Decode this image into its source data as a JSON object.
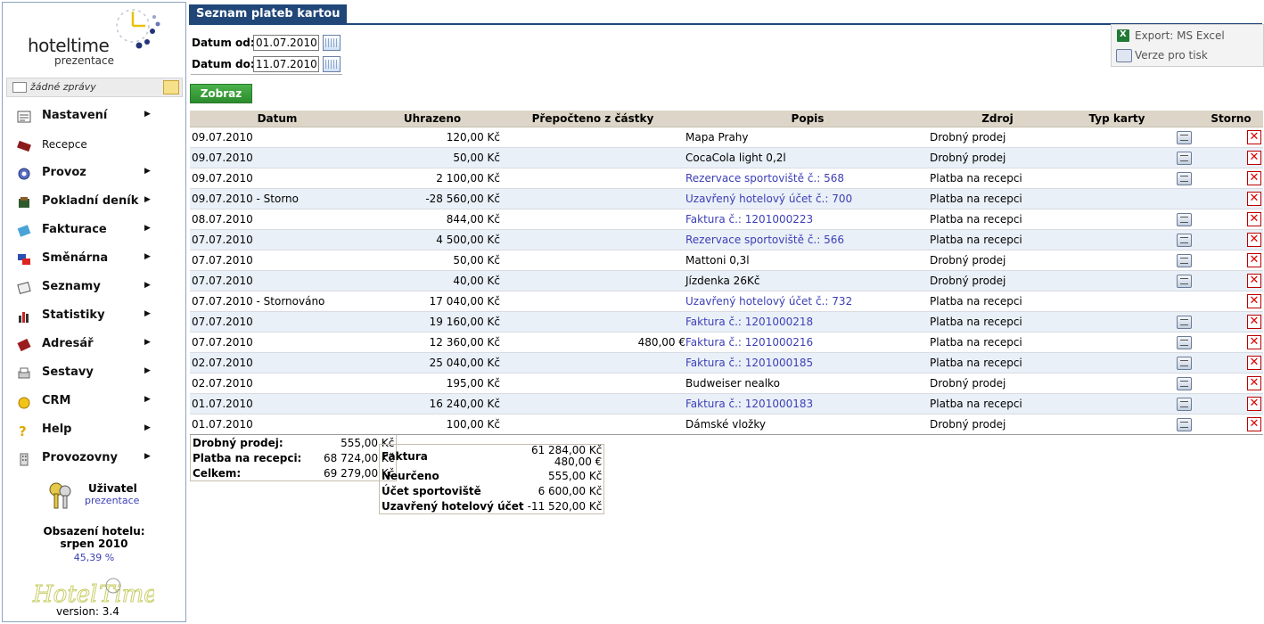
{
  "app": {
    "logo_text": "hoteltime",
    "logo_sub": "prezentace",
    "messages": "žádné zprávy"
  },
  "menu": [
    {
      "label": "Nastavení",
      "icon": "settings-icon",
      "arrow": true
    },
    {
      "label": "Recepce",
      "icon": "reception-icon",
      "arrow": false
    },
    {
      "label": "Provoz",
      "icon": "operations-icon",
      "arrow": true
    },
    {
      "label": "Pokladní deník",
      "icon": "cashbook-icon",
      "arrow": true
    },
    {
      "label": "Fakturace",
      "icon": "invoice-icon",
      "arrow": true
    },
    {
      "label": "Směnárna",
      "icon": "exchange-icon",
      "arrow": true
    },
    {
      "label": "Seznamy",
      "icon": "lists-icon",
      "arrow": true
    },
    {
      "label": "Statistiky",
      "icon": "statistics-icon",
      "arrow": true
    },
    {
      "label": "Adresář",
      "icon": "address-book-icon",
      "arrow": true
    },
    {
      "label": "Sestavy",
      "icon": "reports-icon",
      "arrow": true
    },
    {
      "label": "CRM",
      "icon": "crm-icon",
      "arrow": true
    },
    {
      "label": "Help",
      "icon": "help-icon",
      "arrow": true
    },
    {
      "label": "Provozovny",
      "icon": "branches-icon",
      "arrow": true
    }
  ],
  "user": {
    "title": "Uživatel",
    "name": "prezentace"
  },
  "occupancy": {
    "line1": "Obsazení hotelu:",
    "line2": "srpen 2010",
    "value": "45,39 %"
  },
  "version": "version: 3.4",
  "page": {
    "title": "Seznam plateb kartou"
  },
  "filters": {
    "from_label": "Datum od:",
    "from_value": "01.07.2010",
    "to_label": "Datum do:",
    "to_value": "11.07.2010",
    "show_button": "Zobraz"
  },
  "export": {
    "excel": "Export: MS Excel",
    "print": "Verze pro tisk"
  },
  "table": {
    "headers": [
      "Datum",
      "Uhrazeno",
      "Přepočteno z částky",
      "Popis",
      "Zdroj",
      "Typ karty",
      "",
      "Storno"
    ],
    "rows": [
      {
        "datum": "09.07.2010",
        "uhrazeno": "120,00 Kč",
        "prepocteno": "",
        "popis": "Mapa Prahy",
        "link": false,
        "zdroj": "Drobný prodej",
        "print": true
      },
      {
        "datum": "09.07.2010",
        "uhrazeno": "50,00 Kč",
        "prepocteno": "",
        "popis": "CocaCola light 0,2l",
        "link": false,
        "zdroj": "Drobný prodej",
        "print": true
      },
      {
        "datum": "09.07.2010",
        "uhrazeno": "2 100,00 Kč",
        "prepocteno": "",
        "popis": "Rezervace sportoviště č.: 568",
        "link": true,
        "zdroj": "Platba na recepci",
        "print": true
      },
      {
        "datum": "09.07.2010 - Storno",
        "uhrazeno": "-28 560,00 Kč",
        "prepocteno": "",
        "popis": "Uzavřený hotelový účet č.: 700",
        "link": true,
        "zdroj": "Platba na recepci",
        "print": false
      },
      {
        "datum": "08.07.2010",
        "uhrazeno": "844,00 Kč",
        "prepocteno": "",
        "popis": "Faktura č.: 1201000223",
        "link": true,
        "zdroj": "Platba na recepci",
        "print": true
      },
      {
        "datum": "07.07.2010",
        "uhrazeno": "4 500,00 Kč",
        "prepocteno": "",
        "popis": "Rezervace sportoviště č.: 566",
        "link": true,
        "zdroj": "Platba na recepci",
        "print": true
      },
      {
        "datum": "07.07.2010",
        "uhrazeno": "50,00 Kč",
        "prepocteno": "",
        "popis": "Mattoni 0,3l",
        "link": false,
        "zdroj": "Drobný prodej",
        "print": true
      },
      {
        "datum": "07.07.2010",
        "uhrazeno": "40,00 Kč",
        "prepocteno": "",
        "popis": "Jízdenka 26Kč",
        "link": false,
        "zdroj": "Drobný prodej",
        "print": true
      },
      {
        "datum": "07.07.2010 - Stornováno",
        "uhrazeno": "17 040,00 Kč",
        "prepocteno": "",
        "popis": "Uzavřený hotelový účet č.: 732",
        "link": true,
        "zdroj": "Platba na recepci",
        "print": false
      },
      {
        "datum": "07.07.2010",
        "uhrazeno": "19 160,00 Kč",
        "prepocteno": "",
        "popis": "Faktura č.: 1201000218",
        "link": true,
        "zdroj": "Platba na recepci",
        "print": true
      },
      {
        "datum": "07.07.2010",
        "uhrazeno": "12 360,00 Kč",
        "prepocteno": "480,00 €",
        "popis": "Faktura č.: 1201000216",
        "link": true,
        "zdroj": "Platba na recepci",
        "print": true
      },
      {
        "datum": "02.07.2010",
        "uhrazeno": "25 040,00 Kč",
        "prepocteno": "",
        "popis": "Faktura č.: 1201000185",
        "link": true,
        "zdroj": "Platba na recepci",
        "print": true
      },
      {
        "datum": "02.07.2010",
        "uhrazeno": "195,00 Kč",
        "prepocteno": "",
        "popis": "Budweiser nealko",
        "link": false,
        "zdroj": "Drobný prodej",
        "print": true
      },
      {
        "datum": "01.07.2010",
        "uhrazeno": "16 240,00 Kč",
        "prepocteno": "",
        "popis": "Faktura č.: 1201000183",
        "link": true,
        "zdroj": "Platba na recepci",
        "print": true
      },
      {
        "datum": "01.07.2010",
        "uhrazeno": "100,00 Kč",
        "prepocteno": "",
        "popis": "Dámské vložky",
        "link": false,
        "zdroj": "Drobný prodej",
        "print": true
      }
    ]
  },
  "summary_source": [
    {
      "label": "Drobný prodej:",
      "value": "555,00 Kč"
    },
    {
      "label": "Platba na recepci:",
      "value": "68 724,00 Kč"
    },
    {
      "label": "Celkem:",
      "value": "69 279,00 Kč"
    }
  ],
  "summary_type": [
    {
      "label": "Faktura",
      "value": "61 284,00 Kč",
      "value2": "480,00 €"
    },
    {
      "label": "Neurčeno",
      "value": "555,00 Kč",
      "value2": ""
    },
    {
      "label": "Účet sportoviště",
      "value": "6 600,00 Kč",
      "value2": ""
    },
    {
      "label": "Uzavřený hotelový účet",
      "value": "-11 520,00 Kč",
      "value2": ""
    }
  ],
  "colors": {
    "title_bg": "#214778",
    "link": "#3b3fb5",
    "button": "#2f9a2f",
    "row_alt": "#eaf0f8",
    "header_bg": "#ddd6c8",
    "storno": "#dd0000"
  }
}
